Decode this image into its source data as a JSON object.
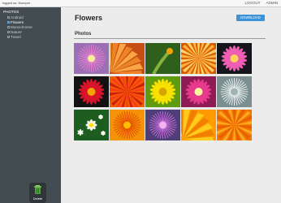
{
  "status": {
    "logged_as": "logged as: thumper"
  },
  "topnav": {
    "logout": "LOGOUT",
    "admin": "ADMIN"
  },
  "sidebar": {
    "root": "PHOTOS",
    "items": [
      {
        "label": "Android",
        "active": false
      },
      {
        "label": "Flowers",
        "active": true
      },
      {
        "label": "Monochrome",
        "active": false
      },
      {
        "label": "Nature",
        "active": false
      },
      {
        "label": "Travel",
        "active": false
      }
    ]
  },
  "main": {
    "title": "Flowers",
    "download_label": "DOWNLOAD",
    "section_title": "Photos"
  },
  "delete": {
    "label": "Delete"
  },
  "colors": {
    "sidebar_bg": "#434c50",
    "accent_blue": "#3b94d9",
    "page_bg": "#ececec"
  },
  "photos": [
    {
      "name": "pink-spiky-flower",
      "bg": "#9a6fb4",
      "petal": "#e47ccf",
      "center": "#f3ef9c",
      "kind": "spikes"
    },
    {
      "name": "orange-macro",
      "bg": "#c74d12",
      "petal": "#f08a2a",
      "center": "#ffb04a",
      "kind": "fan"
    },
    {
      "name": "green-bud",
      "bg": "#2f5f1c",
      "petal": "#85b23d",
      "center": "#f2a200",
      "kind": "bud"
    },
    {
      "name": "orange-petals",
      "bg": "#d85a00",
      "petal": "#ffb13c",
      "center": "#ffd06a",
      "kind": "rays"
    },
    {
      "name": "pink-daisy",
      "bg": "#15151c",
      "petal": "#ef5eb3",
      "center": "#ffd45a",
      "kind": "daisy"
    },
    {
      "name": "red-gerbera",
      "bg": "#121212",
      "petal": "#d9142a",
      "center": "#f6a100",
      "kind": "daisy"
    },
    {
      "name": "orange-red-flower",
      "bg": "#ea6200",
      "petal": "#ff3b17",
      "center": "#d41d0c",
      "kind": "rays"
    },
    {
      "name": "yellow-daisy",
      "bg": "#5f9b0e",
      "petal": "#f8e000",
      "center": "#d7a300",
      "kind": "daisy"
    },
    {
      "name": "pink-gerbera",
      "bg": "#8f1b55",
      "petal": "#e83a8d",
      "center": "#fff3a4",
      "kind": "daisy"
    },
    {
      "name": "white-seed-head",
      "bg": "#7b8f90",
      "petal": "#e8eeee",
      "center": "#9fb3b3",
      "kind": "spikes"
    },
    {
      "name": "white-flower",
      "bg": "#1d5d1f",
      "petal": "#f5f7ec",
      "center": "#ffe100",
      "kind": "small"
    },
    {
      "name": "orange-burst",
      "bg": "#f49308",
      "petal": "#e54f00",
      "center": "#ffbf00",
      "kind": "spikes"
    },
    {
      "name": "purple-flower",
      "bg": "#4f3e77",
      "petal": "#c06ad7",
      "center": "#f2b4ee",
      "kind": "spikes"
    },
    {
      "name": "orange-wedge",
      "bg": "#ff9b00",
      "petal": "#ffd020",
      "center": "#f07b00",
      "kind": "fan"
    },
    {
      "name": "orange-gerbera",
      "bg": "#f17900",
      "petal": "#ffab21",
      "center": "#ea5d00",
      "kind": "rays"
    }
  ]
}
